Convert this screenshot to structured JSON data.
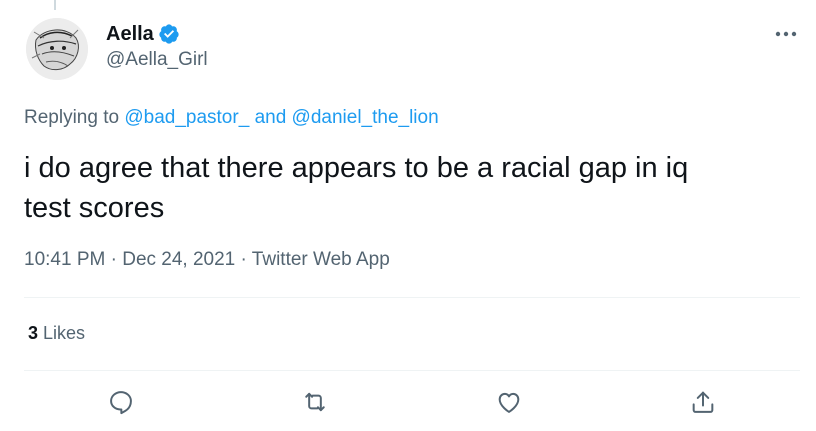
{
  "tweet": {
    "author": {
      "display_name": "Aella",
      "handle": "@Aella_Girl",
      "verified": true
    },
    "reply_prefix": "Replying to",
    "reply_users": [
      "@bad_pastor_",
      "@daniel_the_lion"
    ],
    "reply_conjunction": "and",
    "text_line1": "i do agree that there appears to be a racial gap in iq",
    "text_line2": "test scores",
    "time": "10:41 PM",
    "date": "Dec 24, 2021",
    "source": "Twitter Web App",
    "separator": "·",
    "likes_count": "3",
    "likes_label": "Likes"
  },
  "icons": {
    "more": "more-horizontal-icon",
    "reply": "reply-icon",
    "retweet": "retweet-icon",
    "like": "heart-icon",
    "share": "share-icon",
    "verified": "verified-badge-icon"
  },
  "colors": {
    "link": "#1d9bf0",
    "secondary_text": "#536471",
    "primary_text": "#0f1419",
    "divider": "#eff3f4"
  }
}
